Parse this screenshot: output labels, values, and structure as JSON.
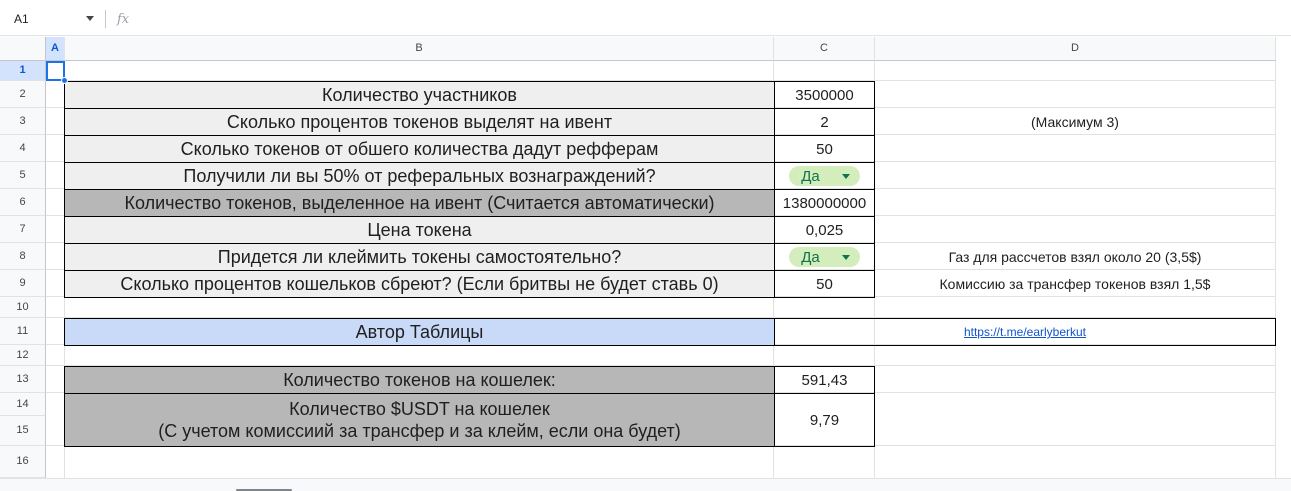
{
  "formula_bar": {
    "name_box": "A1",
    "fx_label": "fx"
  },
  "columns": [
    "A",
    "B",
    "C",
    "D"
  ],
  "rows": [
    "1",
    "2",
    "3",
    "4",
    "5",
    "6",
    "7",
    "8",
    "9",
    "10",
    "11",
    "12",
    "13",
    "14",
    "15",
    "16"
  ],
  "cells": {
    "B2": "Количество участников",
    "C2": "3500000",
    "B3": "Сколько процентов токенов выделят на ивент",
    "C3": "2",
    "D3": "(Максимум 3)",
    "B4": "Сколько токенов от обшего количества дадут рефферам",
    "C4": "50",
    "B5": "Получили ли вы 50% от реферальных вознаграждений?",
    "C5": "Да",
    "B6": "Количество токенов, выделенное на ивент (Считается автоматически)",
    "C6": "1380000000",
    "B7": "Цена токена",
    "C7": "0,025",
    "B8": "Придется ли клеймить токены самостоятельно?",
    "C8": "Да",
    "D8": "Газ для рассчетов взял около 20 (3,5$)",
    "B9": "Сколько процентов кошельков сбреют? (Если бритвы не будет ставь 0)",
    "C9": "50",
    "D9": "Комиссию за трансфер токенов взял 1,5$",
    "B11": "Автор Таблицы",
    "C11": "https://t.me/earlyberkut",
    "B13": "Количество токенов на кошелек:",
    "C13": "591,43",
    "B14_line1": "Количество $USDT на кошелек",
    "B14_line2": "(С учетом комиссиий за трансфер и за клейм, если она будет)",
    "C14": "9,79"
  },
  "colors": {
    "label_bg": "#efefef",
    "result_bg": "#b7b7b7",
    "author_bg": "#c9daf8",
    "chip_bg": "#d4edbc",
    "chip_text": "#11734b",
    "link": "#1155cc",
    "selection": "#1a73e8"
  },
  "icons": {
    "name_box_dropdown": "chevron-down-icon",
    "chip_dropdown": "caret-down-icon"
  }
}
